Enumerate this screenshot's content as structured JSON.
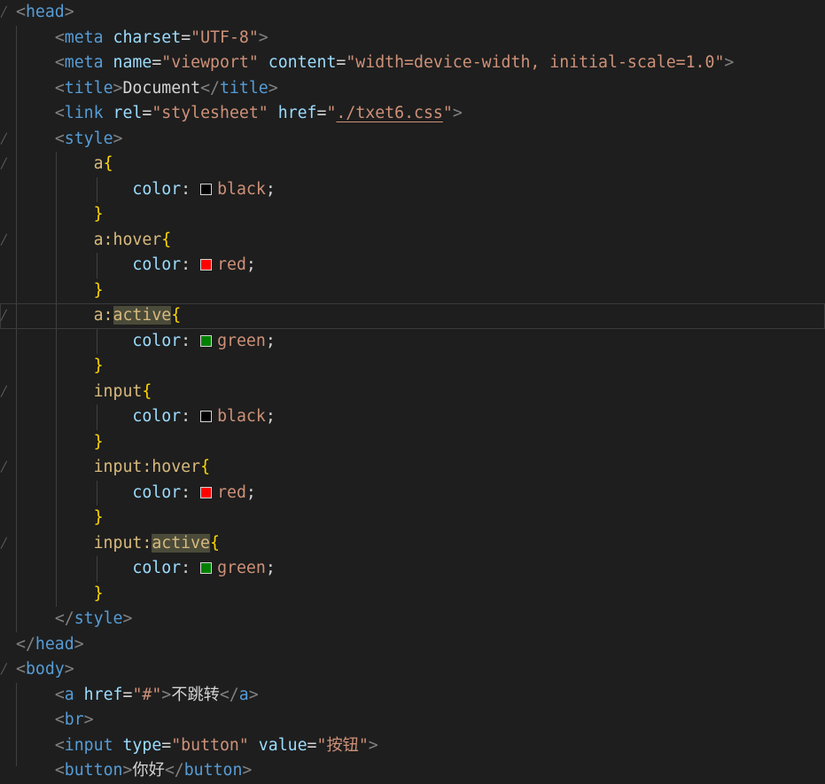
{
  "colors": {
    "background": "#1e1e1e",
    "tag": "#569cd6",
    "attribute": "#9cdcfe",
    "string": "#ce9178",
    "selector": "#d7ba7d",
    "brace": "#ffd700",
    "punctuation": "#808080",
    "text": "#d4d4d4",
    "swatch_black": "#000000",
    "swatch_red": "#ff0000",
    "swatch_green": "#008000"
  },
  "lines": [
    {
      "fold": true,
      "current": false,
      "tokens": [
        {
          "c": "t-punc",
          "t": "<"
        },
        {
          "c": "t-tag",
          "t": "head"
        },
        {
          "c": "t-punc",
          "t": ">"
        }
      ]
    },
    {
      "fold": false,
      "current": false,
      "tokens": [
        {
          "c": "t-plain",
          "t": "    "
        },
        {
          "c": "t-punc",
          "t": "<"
        },
        {
          "c": "t-tag",
          "t": "meta"
        },
        {
          "c": "t-plain",
          "t": " "
        },
        {
          "c": "t-attr",
          "t": "charset"
        },
        {
          "c": "t-plain",
          "t": "="
        },
        {
          "c": "t-str",
          "t": "\"UTF-8\""
        },
        {
          "c": "t-punc",
          "t": ">"
        }
      ]
    },
    {
      "fold": false,
      "current": false,
      "tokens": [
        {
          "c": "t-plain",
          "t": "    "
        },
        {
          "c": "t-punc",
          "t": "<"
        },
        {
          "c": "t-tag",
          "t": "meta"
        },
        {
          "c": "t-plain",
          "t": " "
        },
        {
          "c": "t-attr",
          "t": "name"
        },
        {
          "c": "t-plain",
          "t": "="
        },
        {
          "c": "t-str",
          "t": "\"viewport\""
        },
        {
          "c": "t-plain",
          "t": " "
        },
        {
          "c": "t-attr",
          "t": "content"
        },
        {
          "c": "t-plain",
          "t": "="
        },
        {
          "c": "t-str",
          "t": "\"width=device-width, initial-scale=1.0\""
        },
        {
          "c": "t-punc",
          "t": ">"
        }
      ]
    },
    {
      "fold": false,
      "current": false,
      "tokens": [
        {
          "c": "t-plain",
          "t": "    "
        },
        {
          "c": "t-punc",
          "t": "<"
        },
        {
          "c": "t-tag",
          "t": "title"
        },
        {
          "c": "t-punc",
          "t": ">"
        },
        {
          "c": "t-text",
          "t": "Document"
        },
        {
          "c": "t-punc",
          "t": "</"
        },
        {
          "c": "t-tag",
          "t": "title"
        },
        {
          "c": "t-punc",
          "t": ">"
        }
      ]
    },
    {
      "fold": false,
      "current": false,
      "tokens": [
        {
          "c": "t-plain",
          "t": "    "
        },
        {
          "c": "t-punc",
          "t": "<"
        },
        {
          "c": "t-tag",
          "t": "link"
        },
        {
          "c": "t-plain",
          "t": " "
        },
        {
          "c": "t-attr",
          "t": "rel"
        },
        {
          "c": "t-plain",
          "t": "="
        },
        {
          "c": "t-str",
          "t": "\"stylesheet\""
        },
        {
          "c": "t-plain",
          "t": " "
        },
        {
          "c": "t-attr",
          "t": "href"
        },
        {
          "c": "t-plain",
          "t": "="
        },
        {
          "c": "t-str",
          "t": "\""
        },
        {
          "c": "t-link",
          "t": "./txet6.css"
        },
        {
          "c": "t-str",
          "t": "\""
        },
        {
          "c": "t-punc",
          "t": ">"
        }
      ]
    },
    {
      "fold": true,
      "current": false,
      "tokens": [
        {
          "c": "t-plain",
          "t": "    "
        },
        {
          "c": "t-punc",
          "t": "<"
        },
        {
          "c": "t-tag",
          "t": "style"
        },
        {
          "c": "t-punc",
          "t": ">"
        }
      ]
    },
    {
      "fold": true,
      "current": false,
      "tokens": [
        {
          "c": "t-plain",
          "t": "        "
        },
        {
          "c": "t-sel",
          "t": "a"
        },
        {
          "c": "t-brace",
          "t": "{"
        }
      ]
    },
    {
      "fold": false,
      "current": false,
      "tokens": [
        {
          "c": "t-plain",
          "t": "            "
        },
        {
          "c": "t-prop",
          "t": "color"
        },
        {
          "c": "t-plain",
          "t": ": "
        },
        {
          "c": "swatch",
          "color": "#000000"
        },
        {
          "c": "t-val",
          "t": "black"
        },
        {
          "c": "t-plain",
          "t": ";"
        }
      ]
    },
    {
      "fold": false,
      "current": false,
      "tokens": [
        {
          "c": "t-plain",
          "t": "        "
        },
        {
          "c": "t-brace",
          "t": "}"
        }
      ]
    },
    {
      "fold": true,
      "current": false,
      "tokens": [
        {
          "c": "t-plain",
          "t": "        "
        },
        {
          "c": "t-sel",
          "t": "a:hover"
        },
        {
          "c": "t-brace",
          "t": "{"
        }
      ]
    },
    {
      "fold": false,
      "current": false,
      "tokens": [
        {
          "c": "t-plain",
          "t": "            "
        },
        {
          "c": "t-prop",
          "t": "color"
        },
        {
          "c": "t-plain",
          "t": ": "
        },
        {
          "c": "swatch",
          "color": "#ff0000"
        },
        {
          "c": "t-val",
          "t": "red"
        },
        {
          "c": "t-plain",
          "t": ";"
        }
      ]
    },
    {
      "fold": false,
      "current": false,
      "tokens": [
        {
          "c": "t-plain",
          "t": "        "
        },
        {
          "c": "t-brace",
          "t": "}"
        }
      ]
    },
    {
      "fold": true,
      "current": true,
      "tokens": [
        {
          "c": "t-plain",
          "t": "        "
        },
        {
          "c": "t-sel",
          "t": "a:"
        },
        {
          "c": "cursor"
        },
        {
          "c": "t-sel hl",
          "t": "active"
        },
        {
          "c": "t-brace",
          "t": "{"
        }
      ]
    },
    {
      "fold": false,
      "current": false,
      "tokens": [
        {
          "c": "t-plain",
          "t": "            "
        },
        {
          "c": "t-prop",
          "t": "color"
        },
        {
          "c": "t-plain",
          "t": ": "
        },
        {
          "c": "swatch",
          "color": "#008000"
        },
        {
          "c": "t-val",
          "t": "green"
        },
        {
          "c": "t-plain",
          "t": ";"
        }
      ]
    },
    {
      "fold": false,
      "current": false,
      "tokens": [
        {
          "c": "t-plain",
          "t": "        "
        },
        {
          "c": "t-brace",
          "t": "}"
        }
      ]
    },
    {
      "fold": true,
      "current": false,
      "tokens": [
        {
          "c": "t-plain",
          "t": "        "
        },
        {
          "c": "t-sel",
          "t": "input"
        },
        {
          "c": "t-brace",
          "t": "{"
        }
      ]
    },
    {
      "fold": false,
      "current": false,
      "tokens": [
        {
          "c": "t-plain",
          "t": "            "
        },
        {
          "c": "t-prop",
          "t": "color"
        },
        {
          "c": "t-plain",
          "t": ": "
        },
        {
          "c": "swatch",
          "color": "#000000"
        },
        {
          "c": "t-val",
          "t": "black"
        },
        {
          "c": "t-plain",
          "t": ";"
        }
      ]
    },
    {
      "fold": false,
      "current": false,
      "tokens": [
        {
          "c": "t-plain",
          "t": "        "
        },
        {
          "c": "t-brace",
          "t": "}"
        }
      ]
    },
    {
      "fold": true,
      "current": false,
      "tokens": [
        {
          "c": "t-plain",
          "t": "        "
        },
        {
          "c": "t-sel",
          "t": "input:hover"
        },
        {
          "c": "t-brace",
          "t": "{"
        }
      ]
    },
    {
      "fold": false,
      "current": false,
      "tokens": [
        {
          "c": "t-plain",
          "t": "            "
        },
        {
          "c": "t-prop",
          "t": "color"
        },
        {
          "c": "t-plain",
          "t": ": "
        },
        {
          "c": "swatch",
          "color": "#ff0000"
        },
        {
          "c": "t-val",
          "t": "red"
        },
        {
          "c": "t-plain",
          "t": ";"
        }
      ]
    },
    {
      "fold": false,
      "current": false,
      "tokens": [
        {
          "c": "t-plain",
          "t": "        "
        },
        {
          "c": "t-brace",
          "t": "}"
        }
      ]
    },
    {
      "fold": true,
      "current": false,
      "tokens": [
        {
          "c": "t-plain",
          "t": "        "
        },
        {
          "c": "t-sel",
          "t": "input:"
        },
        {
          "c": "t-sel hl",
          "t": "active"
        },
        {
          "c": "t-brace",
          "t": "{"
        }
      ]
    },
    {
      "fold": false,
      "current": false,
      "tokens": [
        {
          "c": "t-plain",
          "t": "            "
        },
        {
          "c": "t-prop",
          "t": "color"
        },
        {
          "c": "t-plain",
          "t": ": "
        },
        {
          "c": "swatch",
          "color": "#008000"
        },
        {
          "c": "t-val",
          "t": "green"
        },
        {
          "c": "t-plain",
          "t": ";"
        }
      ]
    },
    {
      "fold": false,
      "current": false,
      "tokens": [
        {
          "c": "t-plain",
          "t": "        "
        },
        {
          "c": "t-brace",
          "t": "}"
        }
      ]
    },
    {
      "fold": false,
      "current": false,
      "tokens": [
        {
          "c": "t-plain",
          "t": "    "
        },
        {
          "c": "t-punc",
          "t": "</"
        },
        {
          "c": "t-tag",
          "t": "style"
        },
        {
          "c": "t-punc",
          "t": ">"
        }
      ]
    },
    {
      "fold": false,
      "current": false,
      "tokens": [
        {
          "c": "t-punc",
          "t": "</"
        },
        {
          "c": "t-tag",
          "t": "head"
        },
        {
          "c": "t-punc",
          "t": ">"
        }
      ]
    },
    {
      "fold": true,
      "current": false,
      "tokens": [
        {
          "c": "t-punc",
          "t": "<"
        },
        {
          "c": "t-tag",
          "t": "body"
        },
        {
          "c": "t-punc",
          "t": ">"
        }
      ]
    },
    {
      "fold": false,
      "current": false,
      "tokens": [
        {
          "c": "t-plain",
          "t": "    "
        },
        {
          "c": "t-punc",
          "t": "<"
        },
        {
          "c": "t-tag",
          "t": "a"
        },
        {
          "c": "t-plain",
          "t": " "
        },
        {
          "c": "t-attr",
          "t": "href"
        },
        {
          "c": "t-plain",
          "t": "="
        },
        {
          "c": "t-str",
          "t": "\"#\""
        },
        {
          "c": "t-punc",
          "t": ">"
        },
        {
          "c": "t-text",
          "t": "不跳转"
        },
        {
          "c": "t-punc",
          "t": "</"
        },
        {
          "c": "t-tag",
          "t": "a"
        },
        {
          "c": "t-punc",
          "t": ">"
        }
      ]
    },
    {
      "fold": false,
      "current": false,
      "tokens": [
        {
          "c": "t-plain",
          "t": "    "
        },
        {
          "c": "t-punc",
          "t": "<"
        },
        {
          "c": "t-tag",
          "t": "br"
        },
        {
          "c": "t-punc",
          "t": ">"
        }
      ]
    },
    {
      "fold": false,
      "current": false,
      "tokens": [
        {
          "c": "t-plain",
          "t": "    "
        },
        {
          "c": "t-punc",
          "t": "<"
        },
        {
          "c": "t-tag",
          "t": "input"
        },
        {
          "c": "t-plain",
          "t": " "
        },
        {
          "c": "t-attr",
          "t": "type"
        },
        {
          "c": "t-plain",
          "t": "="
        },
        {
          "c": "t-str",
          "t": "\"button\""
        },
        {
          "c": "t-plain",
          "t": " "
        },
        {
          "c": "t-attr",
          "t": "value"
        },
        {
          "c": "t-plain",
          "t": "="
        },
        {
          "c": "t-str",
          "t": "\"按钮\""
        },
        {
          "c": "t-punc",
          "t": ">"
        }
      ]
    },
    {
      "fold": false,
      "current": false,
      "tokens": [
        {
          "c": "t-plain",
          "t": "    "
        },
        {
          "c": "t-punc",
          "t": "<"
        },
        {
          "c": "t-tag",
          "t": "button"
        },
        {
          "c": "t-punc",
          "t": ">"
        },
        {
          "c": "t-text",
          "t": "你好"
        },
        {
          "c": "t-punc",
          "t": "</"
        },
        {
          "c": "t-tag",
          "t": "button"
        },
        {
          "c": "t-punc",
          "t": ">"
        }
      ]
    }
  ]
}
